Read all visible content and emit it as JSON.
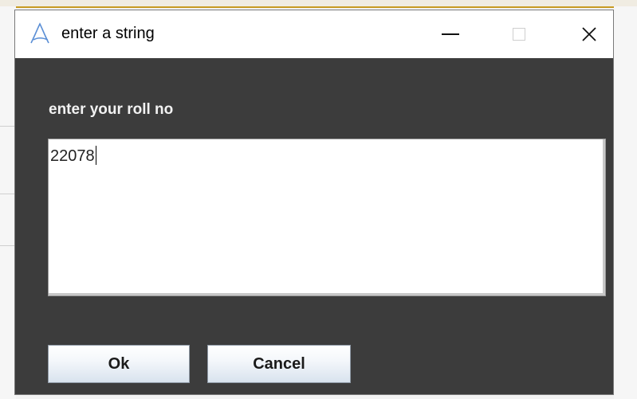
{
  "dialog": {
    "title": "enter a string",
    "prompt": "enter your roll no",
    "input_value": "22078",
    "ok_label": "Ok",
    "cancel_label": "Cancel",
    "icons": {
      "app": "app-logo-icon",
      "minimize": "minimize-icon",
      "maximize": "maximize-icon",
      "close": "close-icon"
    }
  },
  "colors": {
    "dialog_background": "#3c3c3c",
    "titlebar_background": "#ffffff",
    "prompt_text": "#f2f2f2",
    "button_gradient_bottom": "#d9e3ee"
  }
}
